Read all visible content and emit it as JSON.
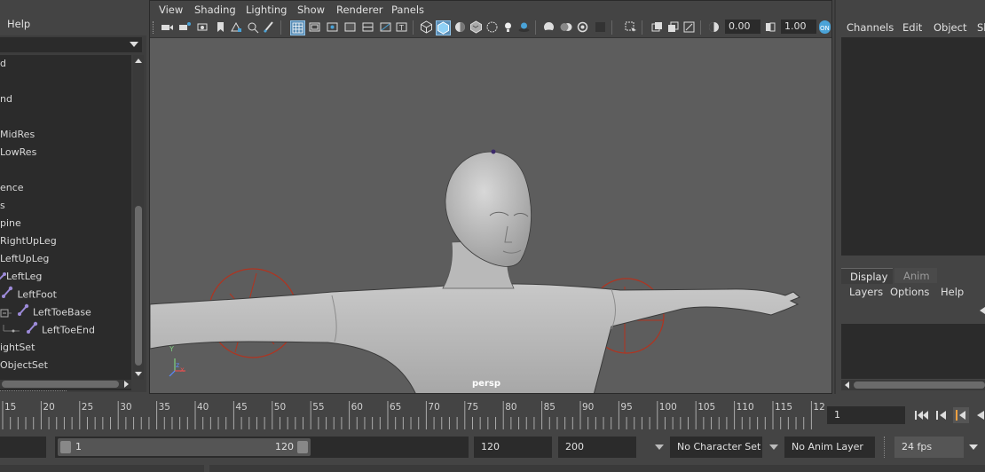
{
  "outliner": {
    "menu_help": "Help",
    "items": [
      "d",
      "",
      "nd",
      "",
      "MidRes",
      "LowRes",
      "",
      "ence",
      "s",
      "pine",
      "RightUpLeg",
      "LeftUpLeg",
      "LeftLeg",
      "LeftFoot",
      "LeftToeBase",
      "LeftToeEnd",
      "ightSet",
      "ObjectSet"
    ]
  },
  "viewport": {
    "menus": [
      "View",
      "Shading",
      "Lighting",
      "Show",
      "Renderer",
      "Panels"
    ],
    "exposure": "0.00",
    "gamma": "1.00",
    "camera_label": "persp",
    "axis_y": "Y",
    "axis_z": "z",
    "axis_x": "x"
  },
  "channel_box": {
    "menus": [
      "Channels",
      "Edit",
      "Object",
      "Sh"
    ]
  },
  "layer_panel": {
    "tabs": [
      "Display",
      "Anim"
    ],
    "menus": [
      "Layers",
      "Options",
      "Help"
    ]
  },
  "time_slider": {
    "ticks": [
      "15",
      "20",
      "25",
      "30",
      "35",
      "40",
      "45",
      "50",
      "55",
      "60",
      "65",
      "70",
      "75",
      "80",
      "85",
      "90",
      "95",
      "100",
      "105",
      "110",
      "115",
      "12"
    ],
    "current_frame": "1"
  },
  "range_slider": {
    "start_inner": "1",
    "end_inner": "120",
    "end_field": "120",
    "total_end": "200",
    "character_set": "No Character Set",
    "anim_layer": "No Anim Layer",
    "fps": "24 fps"
  },
  "colors": {
    "accent_blue": "#4aa3d8",
    "joint_purple": "#9c8ad8",
    "control_red": "#b2331f"
  }
}
